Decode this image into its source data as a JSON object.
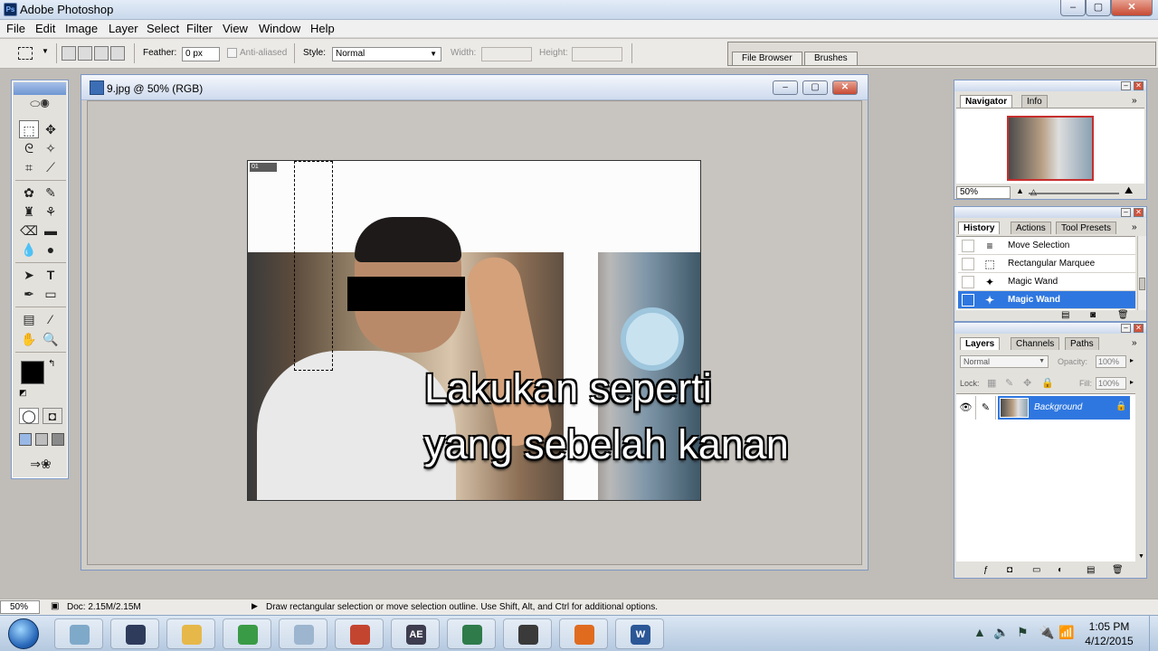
{
  "app": {
    "title": "Adobe Photoshop",
    "logo_text": "Ps",
    "window_controls": {
      "minimize": "–",
      "restore": "▢",
      "close": "✕"
    }
  },
  "menu": [
    "File",
    "Edit",
    "Image",
    "Layer",
    "Select",
    "Filter",
    "View",
    "Window",
    "Help"
  ],
  "options_bar": {
    "feather_label": "Feather:",
    "feather_value": "0 px",
    "anti_aliased_label": "Anti-aliased",
    "style_label": "Style:",
    "style_value": "Normal",
    "width_label": "Width:",
    "height_label": "Height:",
    "well_tabs": [
      "File Browser",
      "Brushes"
    ]
  },
  "document": {
    "title": "9.jpg @ 50% (RGB)",
    "canvas_tag": "01",
    "overlay_lines": [
      "Lakukan seperti",
      "yang sebelah kanan"
    ]
  },
  "navigator": {
    "tabs": [
      "Navigator",
      "Info"
    ],
    "zoom": "50%"
  },
  "history": {
    "tabs": [
      "History",
      "Actions",
      "Tool Presets"
    ],
    "rows": [
      {
        "label": "Move Selection",
        "icon": "move-selection-icon",
        "glyph": "≡"
      },
      {
        "label": "Rectangular Marquee",
        "icon": "marquee-icon",
        "glyph": "⬚"
      },
      {
        "label": "Magic Wand",
        "icon": "magic-wand-icon",
        "glyph": "✦"
      },
      {
        "label": "Magic Wand",
        "icon": "magic-wand-icon",
        "glyph": "✦",
        "selected": true
      }
    ]
  },
  "layers": {
    "tabs": [
      "Layers",
      "Channels",
      "Paths"
    ],
    "blend_mode": "Normal",
    "opacity_label": "Opacity:",
    "opacity_value": "100%",
    "lock_label": "Lock:",
    "fill_label": "Fill:",
    "fill_value": "100%",
    "layer_name": "Background"
  },
  "status_bar": {
    "zoom": "50%",
    "doc_info": "Doc: 2.15M/2.15M",
    "hint": "Draw rectangular selection or move selection outline.  Use Shift, Alt, and Ctrl for additional options."
  },
  "taskbar": {
    "apps": [
      {
        "name": "taskbar-app-notepad",
        "label": "",
        "color": "#7fa9c9"
      },
      {
        "name": "taskbar-app-media",
        "label": "",
        "color": "#2f3b5a"
      },
      {
        "name": "taskbar-app-explorer",
        "label": "",
        "color": "#e6b84a"
      },
      {
        "name": "taskbar-app-chrome",
        "label": "",
        "color": "#3a9b46"
      },
      {
        "name": "taskbar-app-calculator",
        "label": "",
        "color": "#9db5cf"
      },
      {
        "name": "taskbar-app-book",
        "label": "",
        "color": "#c4452f"
      },
      {
        "name": "taskbar-app-aftereffects",
        "label": "AE",
        "color": "#3d3d4f"
      },
      {
        "name": "taskbar-app-publisher",
        "label": "",
        "color": "#2f7b4a"
      },
      {
        "name": "taskbar-app-game",
        "label": "",
        "color": "#3a3a3a"
      },
      {
        "name": "taskbar-app-firefox",
        "label": "",
        "color": "#e06b1f"
      },
      {
        "name": "taskbar-app-word",
        "label": "W",
        "color": "#2b5797"
      }
    ],
    "time": "1:05 PM",
    "date": "4/12/2015"
  },
  "colors": {
    "selection_blue": "#2f77e0",
    "window_frame": "#7d9ac7"
  }
}
